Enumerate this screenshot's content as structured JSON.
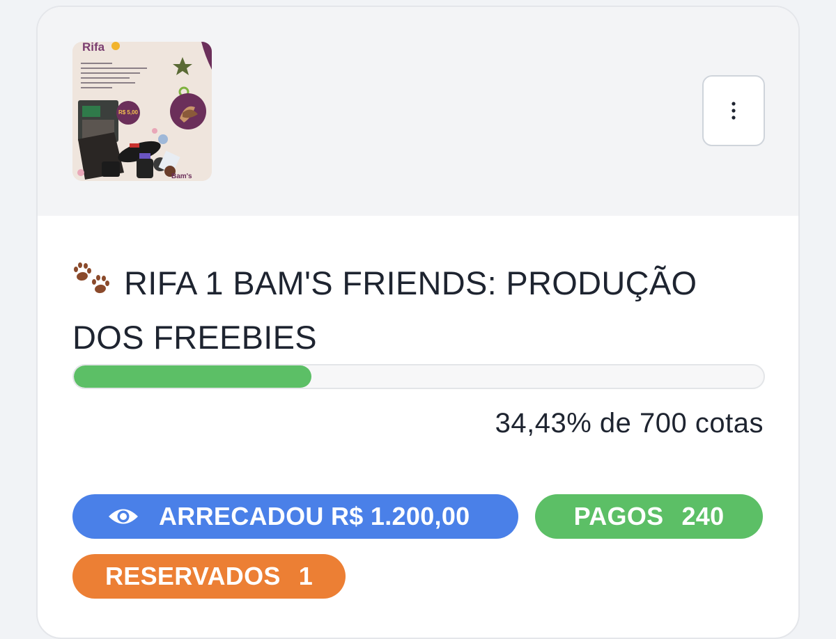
{
  "raffle": {
    "image_alt": "Rifa Bam's Friends",
    "image_text": {
      "heading": "Rifa",
      "price": "R$ 5,00",
      "brand": "Bam's"
    },
    "title": "RIFA 1 BAM'S FRIENDS: PRODUÇÃO DOS FREEBIES",
    "title_icon": "paw-prints-icon",
    "progress_fraction": 0.3443,
    "progress_label": "34,43% de 700 cotas",
    "menu_icon": "kebab-menu-icon"
  },
  "badges": {
    "raised_icon": "eye-icon",
    "raised_label": "ARRECADOU R$ 1.200,00",
    "paid_label": "PAGOS",
    "paid_value": "240",
    "reserved_label": "RESERVADOS",
    "reserved_value": "1"
  },
  "colors": {
    "raised": "#4a80e8",
    "paid": "#5cbf66",
    "reserved": "#ec7f34",
    "progress": "#5cbf66"
  }
}
